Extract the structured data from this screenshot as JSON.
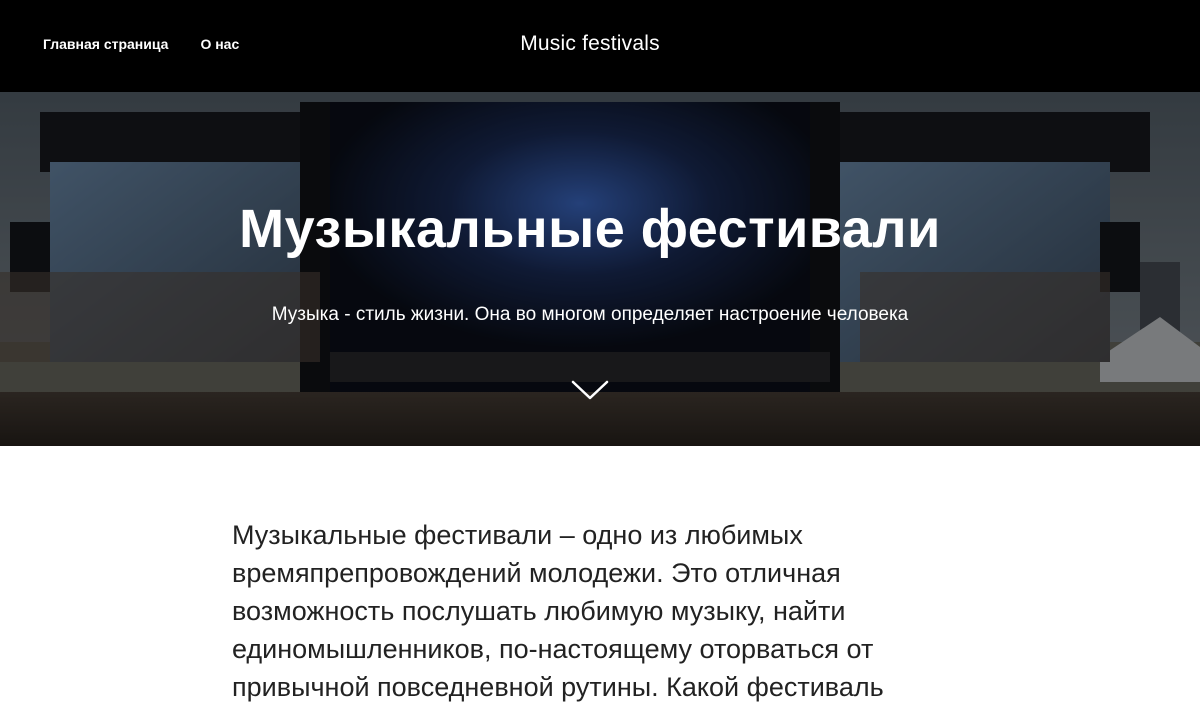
{
  "header": {
    "nav": [
      {
        "label": "Главная страница"
      },
      {
        "label": "О нас"
      }
    ],
    "site_title": "Music festivals"
  },
  "hero": {
    "title": "Музыкальные фестивали",
    "subtitle": "Музыка - стиль жизни. Она во многом определяет настроение человека",
    "scroll_icon": "chevron-down-icon"
  },
  "article": {
    "text": "Музыкальные фестивали – одно из любимых времяпрепровождений молодежи. Это отличная возможность послушать любимую музыку, найти единомышленников, по-настоящему оторваться от привычной повседневной рутины. Какой фестиваль"
  },
  "colors": {
    "header_bg": "#000000",
    "header_text": "#ffffff",
    "body_text": "#222222"
  }
}
